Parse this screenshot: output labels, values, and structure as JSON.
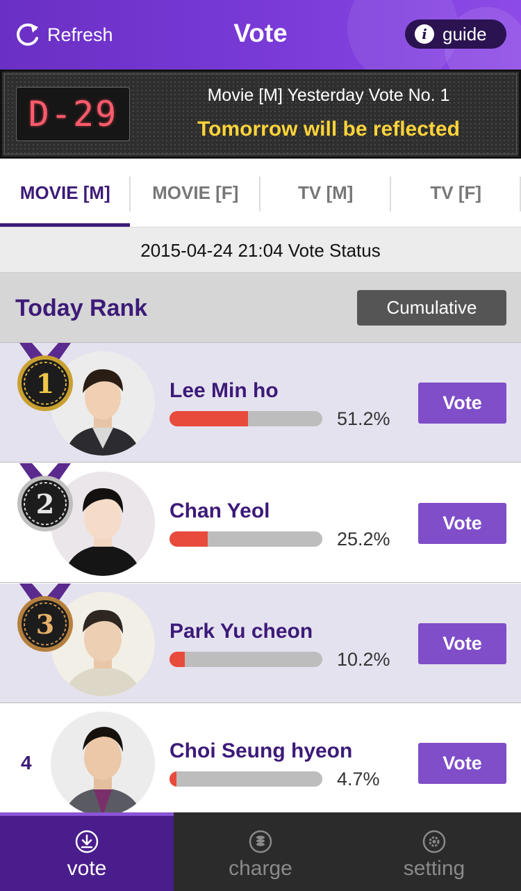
{
  "header": {
    "refresh_label": "Refresh",
    "title": "Vote",
    "guide_label": "guide",
    "refresh_icon": "refresh-icon",
    "info_icon": "info-icon"
  },
  "banner": {
    "dday": "D-29",
    "line1": "Movie [M] Yesterday Vote No. 1",
    "line2": "Tomorrow will be reflected"
  },
  "tabs": [
    {
      "label": "MOVIE [M]",
      "active": true
    },
    {
      "label": "MOVIE [F]",
      "active": false
    },
    {
      "label": "TV [M]",
      "active": false
    },
    {
      "label": "TV [F]",
      "active": false
    }
  ],
  "status_text": "2015-04-24 21:04 Vote Status",
  "rank_section": {
    "title": "Today Rank",
    "cumulative_label": "Cumulative"
  },
  "ranks": [
    {
      "rank": "1",
      "name": "Lee Min ho",
      "percent_text": "51.2%",
      "percent": 51.2,
      "vote_label": "Vote",
      "medal": "gold"
    },
    {
      "rank": "2",
      "name": "Chan Yeol",
      "percent_text": "25.2%",
      "percent": 25.2,
      "vote_label": "Vote",
      "medal": "silver"
    },
    {
      "rank": "3",
      "name": "Park Yu cheon",
      "percent_text": "10.2%",
      "percent": 10.2,
      "vote_label": "Vote",
      "medal": "bronze"
    },
    {
      "rank": "4",
      "name": "Choi Seung hyeon",
      "percent_text": "4.7%",
      "percent": 4.7,
      "vote_label": "Vote",
      "medal": ""
    }
  ],
  "bottom_nav": [
    {
      "label": "vote",
      "icon": "download-circle-icon",
      "active": true
    },
    {
      "label": "charge",
      "icon": "coin-stack-icon",
      "active": false
    },
    {
      "label": "setting",
      "icon": "gear-icon",
      "active": false
    }
  ],
  "colors": {
    "header_purple": "#7a3bd8",
    "brand_dark_purple": "#3c1a78",
    "vote_button": "#7f4ec8",
    "bar_fill": "#e84a3c",
    "dday_red": "#ff5b6b",
    "banner_yellow": "#ffd43a",
    "medal_ribbon": "#5b2a8e"
  }
}
